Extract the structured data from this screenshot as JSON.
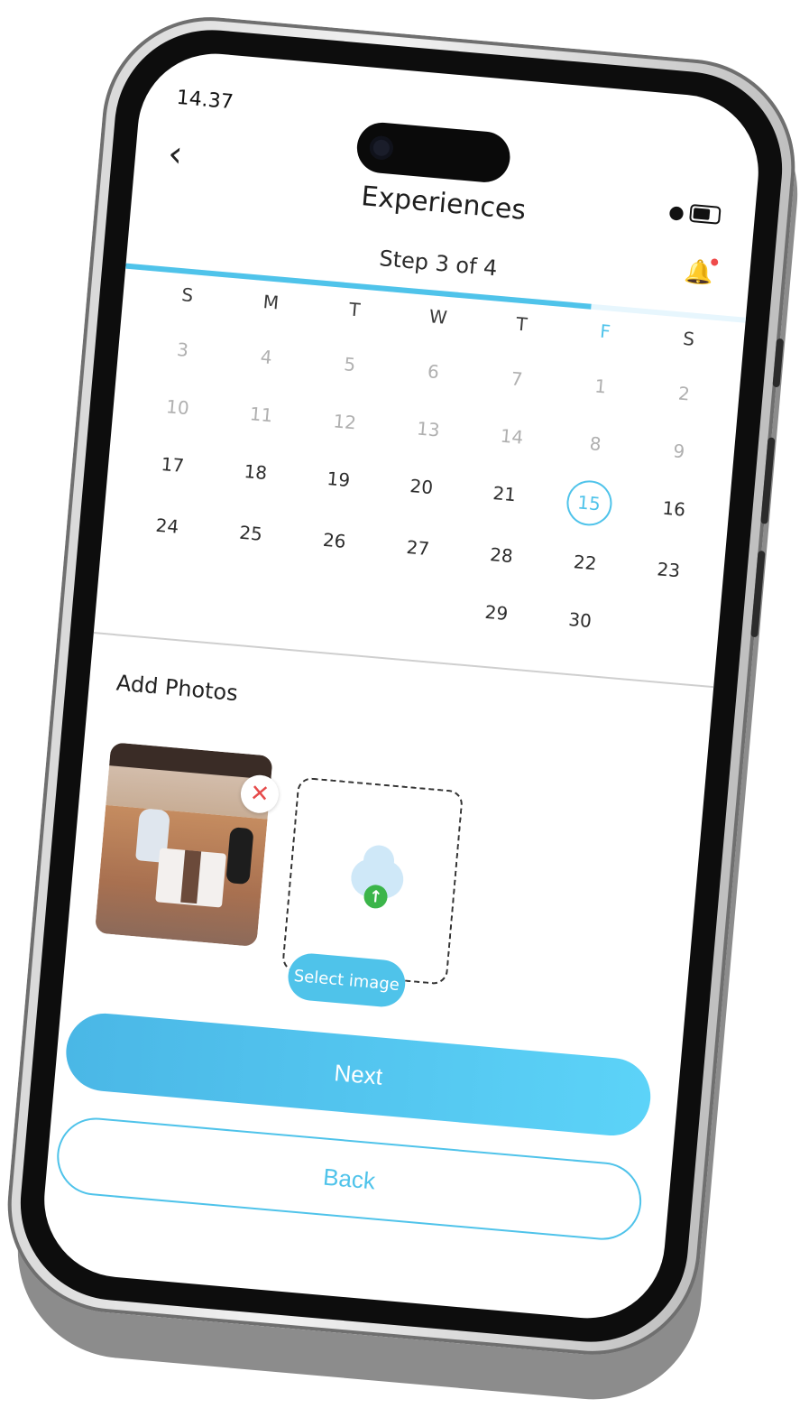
{
  "status_bar": {
    "time": "14.37",
    "location_icon": "location-arrow-icon",
    "wifi_icon": "wifi-icon",
    "battery_icon": "battery-icon"
  },
  "header": {
    "title": "Experiences",
    "back_icon": "chevron-left-icon",
    "notification_icon": "bell-icon"
  },
  "progress": {
    "step_label": "Step 3 of 4",
    "fraction": 0.75,
    "accent": "#4fc3ea"
  },
  "calendar": {
    "weekdays": [
      "S",
      "M",
      "T",
      "W",
      "T",
      "F",
      "S"
    ],
    "active_weekday_index": 5,
    "weeks": [
      [
        "3",
        "4",
        "5",
        "6",
        "7",
        "1",
        "2"
      ],
      [
        "10",
        "11",
        "12",
        "13",
        "14",
        "8",
        "9"
      ],
      [
        "17",
        "18",
        "19",
        "20",
        "21",
        "15",
        "16"
      ],
      [
        "24",
        "25",
        "26",
        "27",
        "28",
        "22",
        "23"
      ],
      [
        "",
        "",
        "",
        "",
        "29",
        "30",
        ""
      ]
    ],
    "selected_day": "15"
  },
  "photos": {
    "section_label": "Add Photos",
    "remove_icon": "close-icon",
    "upload_icon": "cloud-upload-icon",
    "select_label": "Select image"
  },
  "buttons": {
    "next_label": "Next",
    "back_label": "Back"
  },
  "colors": {
    "accent": "#4fc3ea",
    "danger": "#e64b4b",
    "upload_green": "#3bb54a"
  }
}
